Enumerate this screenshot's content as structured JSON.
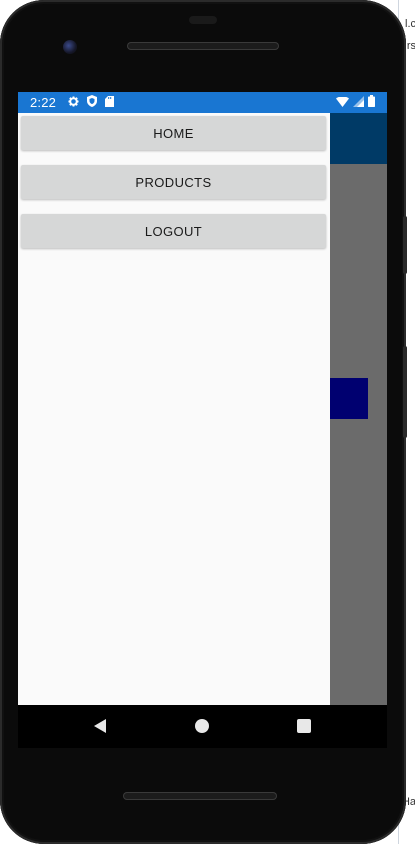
{
  "statusbar": {
    "time": "2:22",
    "left_icons": [
      "gear-icon",
      "shield-icon",
      "sd-card-icon"
    ],
    "right_icons": [
      "wifi-icon",
      "signal-icon",
      "battery-icon"
    ]
  },
  "drawer": {
    "items": [
      {
        "label": "HOME"
      },
      {
        "label": "PRODUCTS"
      },
      {
        "label": "LOGOUT"
      }
    ]
  },
  "navbar": {
    "buttons": [
      "back-icon",
      "home-icon",
      "recents-icon"
    ]
  },
  "background": {
    "fragments": [
      "l.c",
      "rs",
      "Ha"
    ]
  },
  "colors": {
    "statusbar": "#1976d2",
    "app_toolbar": "#003a66",
    "app_box": "#000070",
    "drawer_bg": "#fafafa",
    "button_bg": "#d6d7d7",
    "scrim": "#6b6b6b"
  }
}
